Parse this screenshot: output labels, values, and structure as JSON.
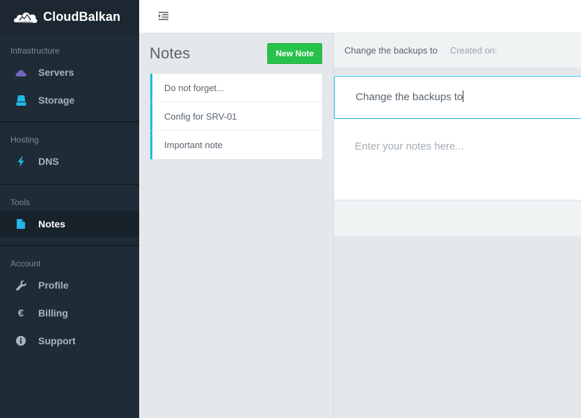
{
  "brand": {
    "name": "CloudBalkan",
    "logo_text": "CloudBalkan"
  },
  "sidebar": {
    "sections": [
      {
        "title": "Infrastructure",
        "items": [
          {
            "label": "Servers",
            "icon": "cloud-icon"
          },
          {
            "label": "Storage",
            "icon": "hard-drive-icon"
          }
        ]
      },
      {
        "title": "Hosting",
        "items": [
          {
            "label": "DNS",
            "icon": "bolt-icon"
          }
        ]
      },
      {
        "title": "Tools",
        "items": [
          {
            "label": "Notes",
            "icon": "file-icon",
            "active": true
          }
        ]
      },
      {
        "title": "Account",
        "items": [
          {
            "label": "Profile",
            "icon": "wrench-icon"
          },
          {
            "label": "Billing",
            "icon": "euro-icon"
          },
          {
            "label": "Support",
            "icon": "info-icon"
          }
        ]
      }
    ]
  },
  "header": {
    "menu_icon": "indent-menu-icon"
  },
  "notes": {
    "title": "Notes",
    "new_button": "New Note",
    "items": [
      {
        "label": "Do not forget..."
      },
      {
        "label": "Config for SRV-01"
      },
      {
        "label": "Important note"
      }
    ]
  },
  "editor": {
    "header_title": "Change the backups to",
    "created_label": "Created on:",
    "title_value": "Change the backups to",
    "body_placeholder": "Enter your notes here..."
  },
  "colors": {
    "sidebar_bg": "#1f2b36",
    "accent_green": "#27c24c",
    "accent_blue": "#23b7e5",
    "servers_icon": "#7266ba",
    "storage_icon": "#23b7e5",
    "dns_icon": "#23b7e5",
    "notes_icon": "#23b7e5"
  }
}
